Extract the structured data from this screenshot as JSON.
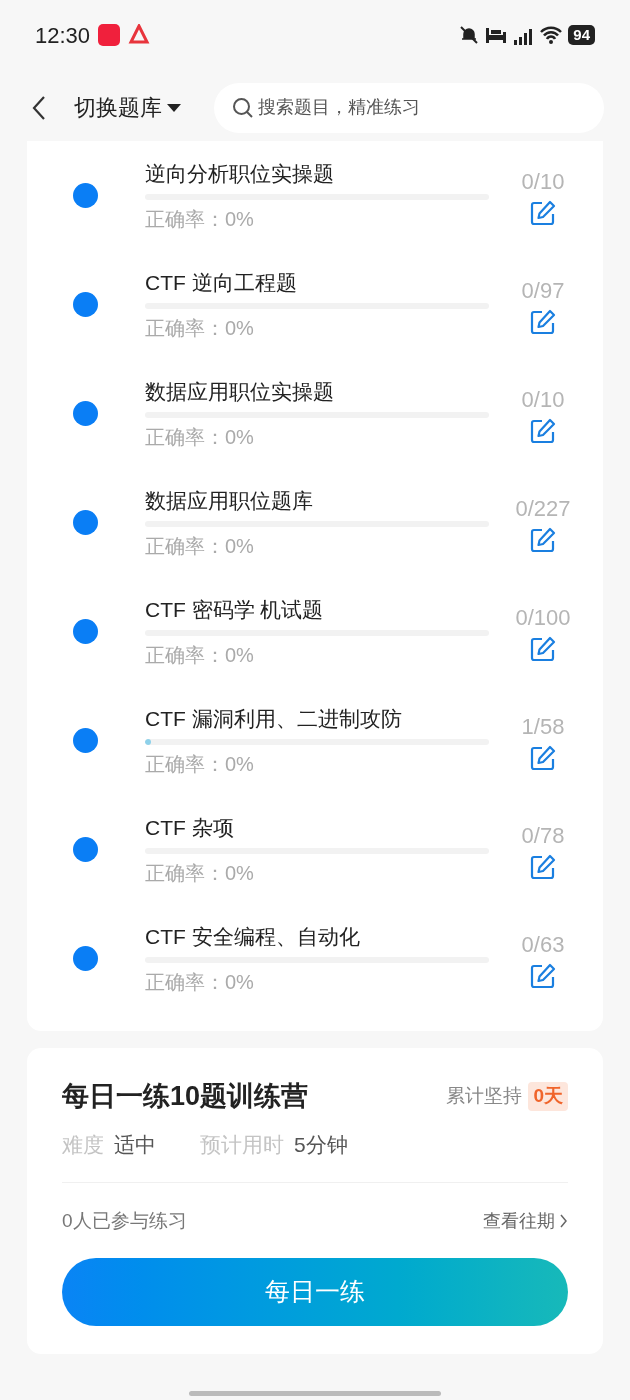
{
  "status_bar": {
    "time": "12:30",
    "battery": "94"
  },
  "header": {
    "title": "切换题库",
    "search": {
      "placeholder": "搜索题目，精准练习"
    }
  },
  "banks": [
    {
      "title": "逆向分析职位实操题",
      "count": "0/10",
      "accuracy": "正确率：0%",
      "level": 0,
      "color": "#0a7ef5"
    },
    {
      "title": "CTF 逆向工程题",
      "count": "0/97",
      "accuracy": "正确率：0%",
      "level": 0,
      "color": "#0a7ef5"
    },
    {
      "title": "数据应用职位实操题",
      "count": "0/10",
      "accuracy": "正确率：0%",
      "level": 0,
      "color": "#0a7ef5"
    },
    {
      "title": "数据应用职位题库",
      "count": "0/227",
      "accuracy": "正确率：0%",
      "level": 0,
      "color": "#0a7ef5"
    },
    {
      "title": "CTF 密码学 机试题",
      "count": "0/100",
      "accuracy": "正确率：0%",
      "level": 0,
      "color": "#0a7ef5"
    },
    {
      "title": "CTF 漏洞利用、二进制攻防",
      "count": "1/58",
      "accuracy": "正确率：0%",
      "level": 0.017,
      "color": "#0a7ef5"
    },
    {
      "title": "CTF 杂项",
      "count": "0/78",
      "accuracy": "正确率：0%",
      "level": 0,
      "color": "#0a7ef5"
    },
    {
      "title": "CTF 安全编程、自动化",
      "count": "0/63",
      "accuracy": "正确率：0%",
      "level": 0,
      "color": "#0a7ef5"
    }
  ],
  "camp": {
    "title": "每日一练10题训练营",
    "streak_label": "累计坚持",
    "streak": "0天",
    "difficulty_label": "难度",
    "difficulty": "适中",
    "time_label": "预计用时",
    "time": "5分钟",
    "participants": "0人已参与练习",
    "history_link": "查看往期",
    "button": "每日一练"
  }
}
